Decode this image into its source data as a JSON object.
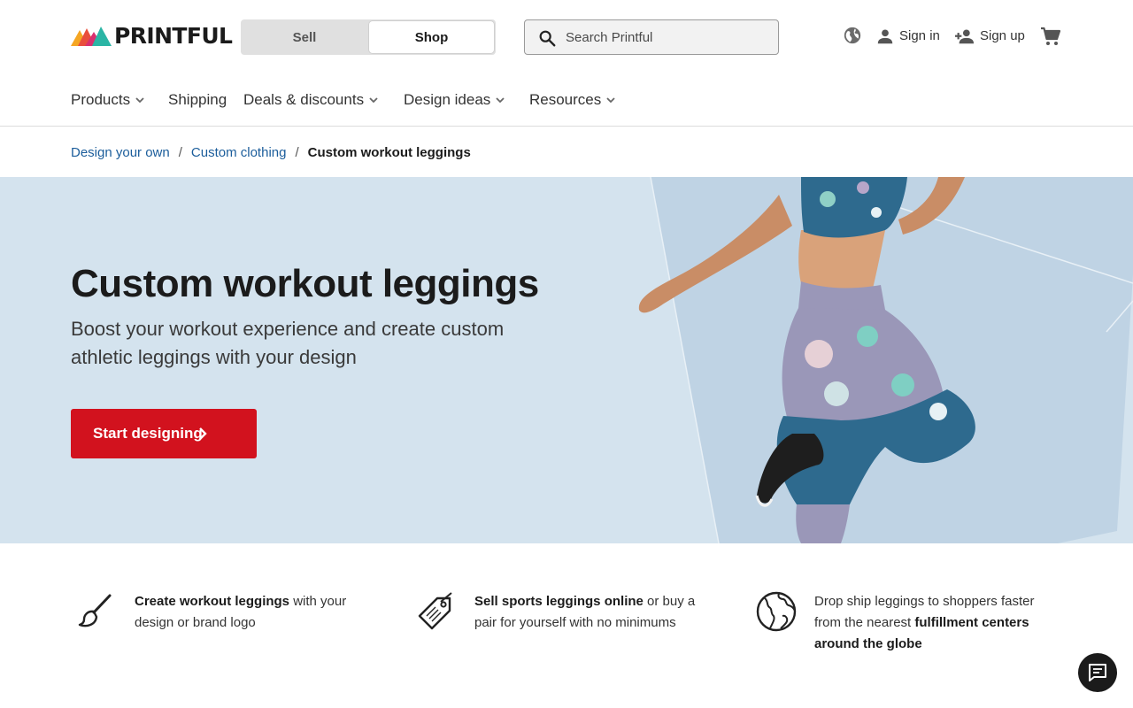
{
  "header": {
    "logo_text": "PRINTFUL",
    "toggle": {
      "sell_label": "Sell",
      "shop_label": "Shop",
      "active": "Shop"
    },
    "search": {
      "placeholder": "Search Printful",
      "value": ""
    },
    "sign_in_label": "Sign in",
    "sign_up_label": "Sign up",
    "icons": [
      "globe-icon",
      "person-icon",
      "person-add-icon",
      "cart-icon",
      "search-icon"
    ]
  },
  "nav": {
    "items": [
      {
        "label": "Products",
        "dropdown": true
      },
      {
        "label": "Shipping",
        "dropdown": false
      },
      {
        "label": "Deals & discounts",
        "dropdown": true
      },
      {
        "label": "Design ideas",
        "dropdown": true
      },
      {
        "label": "Resources",
        "dropdown": true
      }
    ]
  },
  "breadcrumb": {
    "items": [
      "Design your own",
      "Custom clothing"
    ],
    "current": "Custom workout leggings",
    "separator": "/"
  },
  "hero": {
    "title": "Custom workout leggings",
    "subtitle": "Boost your workout experience and create custom athletic leggings with your design",
    "cta_label": "Start designing"
  },
  "features": [
    {
      "icon": "paintbrush-icon",
      "bold": "Create workout leggings",
      "text": " with your design or brand logo"
    },
    {
      "icon": "price-tag-icon",
      "bold": "Sell sports leggings online",
      "text": " or buy a pair for yourself with no minimums"
    },
    {
      "icon": "globe-outline-icon",
      "text_before": "Drop ship leggings to shoppers faster from the nearest ",
      "bold": "fulfillment centers around the globe"
    }
  ],
  "colors": {
    "brand_red": "#d2121e",
    "link_blue": "#1b5d9b",
    "hero_bg": "#d4e3ee",
    "text_dark": "#1b1b1b"
  }
}
